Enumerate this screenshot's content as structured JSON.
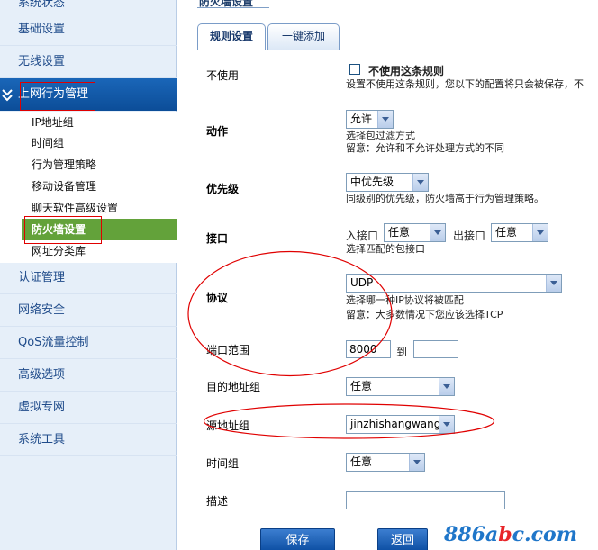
{
  "sidebar": {
    "items": [
      {
        "label": "系统状态"
      },
      {
        "label": "基础设置"
      },
      {
        "label": "无线设置"
      },
      {
        "label": "上网行为管理"
      },
      {
        "label": "认证管理"
      },
      {
        "label": "网络安全"
      },
      {
        "label": "QoS流量控制"
      },
      {
        "label": "高级选项"
      },
      {
        "label": "虚拟专网"
      },
      {
        "label": "系统工具"
      }
    ],
    "sub_items": [
      {
        "label": "IP地址组"
      },
      {
        "label": "时间组"
      },
      {
        "label": "行为管理策略"
      },
      {
        "label": "移动设备管理"
      },
      {
        "label": "聊天软件高级设置"
      },
      {
        "label": "防火墙设置"
      },
      {
        "label": "网址分类库"
      }
    ]
  },
  "header": {
    "title": "防火墙设置"
  },
  "tabs": [
    {
      "label": "规则设置"
    },
    {
      "label": "一键添加"
    }
  ],
  "form": {
    "disable": {
      "label": "不使用",
      "checkbox_label": "不使用这条规则",
      "hint": "设置不使用这条规则，您以下的配置将只会被保存，不"
    },
    "action": {
      "label": "动作",
      "value": "允许",
      "hint1": "选择包过滤方式",
      "hint2": "留意：允许和不允许处理方式的不同"
    },
    "priority": {
      "label": "优先级",
      "value": "中优先级",
      "hint": "同级别的优先级，防火墙高于行为管理策略。"
    },
    "interface": {
      "label": "接口",
      "in_label": "入接口",
      "in_value": "任意",
      "out_label": "出接口",
      "out_value": "任意",
      "hint": "选择匹配的包接口"
    },
    "protocol": {
      "label": "协议",
      "value": "UDP",
      "hint1": "选择哪一种IP协议将被匹配",
      "hint2": "留意：大多数情况下您应该选择TCP"
    },
    "port_range": {
      "label": "端口范围",
      "from": "8000",
      "to_label": "到",
      "to": ""
    },
    "dest_group": {
      "label": "目的地址组",
      "value": "任意"
    },
    "src_group": {
      "label": "源地址组",
      "value": "jinzhishangwang"
    },
    "time_group": {
      "label": "时间组",
      "value": "任意"
    },
    "description": {
      "label": "描述",
      "value": ""
    }
  },
  "buttons": {
    "save": "保存",
    "back": "返回"
  },
  "watermark": {
    "text_a": "886a",
    "text_b": "b",
    "text_c": "c.com"
  },
  "colors": {
    "annotation_red": "#e00000",
    "sidebar_active": "#0c4d98",
    "current_item": "#63a23a"
  }
}
